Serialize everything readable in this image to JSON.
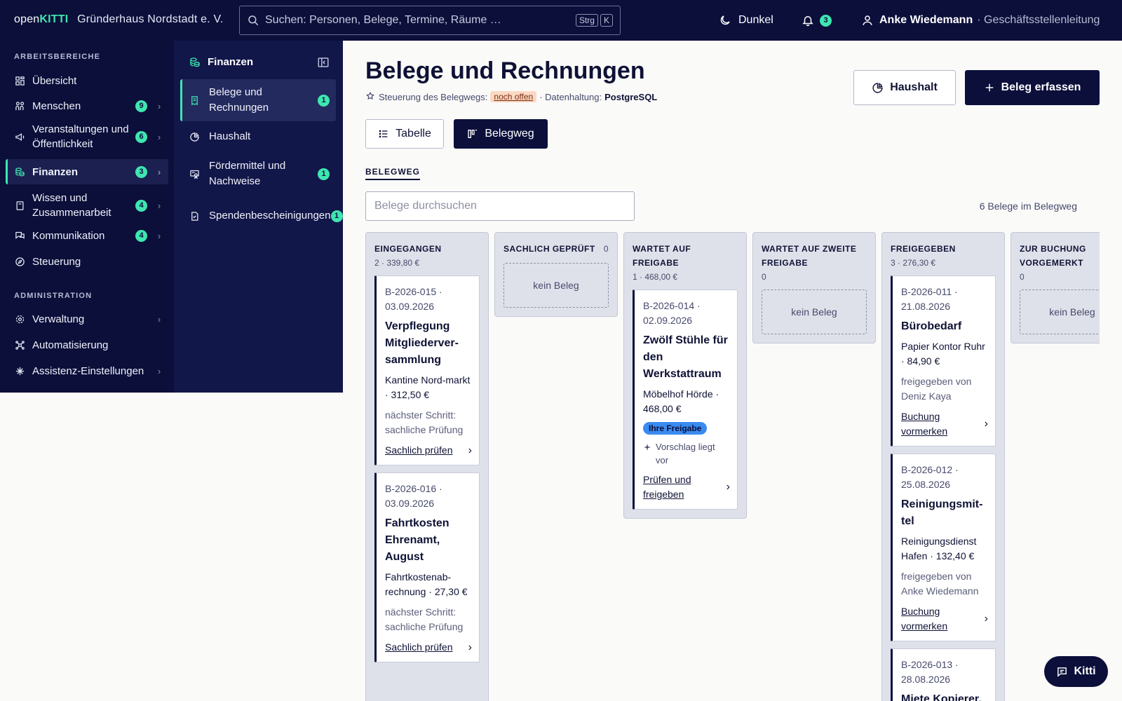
{
  "topbar": {
    "brand_open": "open",
    "brand_kitti": "KITTI",
    "org": "Gründerhaus Nordstadt e. V.",
    "search_placeholder": "Suchen: Personen, Belege, Termine, Räume …",
    "kbd_1": "Strg",
    "kbd_2": "K",
    "theme_label": "Dunkel",
    "notification_count": "3",
    "user_name": "Anke Wiedemann",
    "user_role": "· Geschäftsstellenleitung"
  },
  "nav": {
    "section_work": "ARBEITSBEREICHE",
    "section_admin": "ADMINISTRATION",
    "items": [
      {
        "label": "Übersicht",
        "badge": ""
      },
      {
        "label": "Menschen",
        "badge": "9"
      },
      {
        "label": "Veranstaltungen und Öffentlichkeit",
        "badge": "6"
      },
      {
        "label": "Finanzen",
        "badge": "3"
      },
      {
        "label": "Wissen und Zusammenarbeit",
        "badge": "4"
      },
      {
        "label": "Kommunikation",
        "badge": "4"
      },
      {
        "label": "Steuerung",
        "badge": ""
      }
    ],
    "admin_items": [
      {
        "label": "Verwaltung"
      },
      {
        "label": "Automatisierung"
      },
      {
        "label": "Assistenz-Einstellungen"
      }
    ]
  },
  "subnav": {
    "title": "Finanzen",
    "items": [
      {
        "label": "Belege und Rechnungen",
        "badge": "1"
      },
      {
        "label": "Haushalt",
        "badge": ""
      },
      {
        "label": "Fördermittel und Nachweise",
        "badge": "1"
      },
      {
        "label": "Spendenbescheinigungen",
        "badge": "1"
      }
    ]
  },
  "main": {
    "title": "Belege und Rechnungen",
    "meta_prefix": "Steuerung des Belegwegs:",
    "meta_status": "noch offen",
    "meta_storage_label": "· Datenhaltung:",
    "meta_storage_value": "PostgreSQL",
    "btn_budget": "Haushalt",
    "btn_add": "Beleg erfassen",
    "view_table": "Tabelle",
    "view_board": "Belegweg",
    "tab_label": "BELEGWEG",
    "filter_placeholder": "Belege durchsuchen",
    "count_text": "6 Belege im Belegweg"
  },
  "board": {
    "columns": [
      {
        "title": "EINGEGANGEN",
        "count": "",
        "summary": "2 · 339,80 €"
      },
      {
        "title": "SACHLICH GEPRÜFT",
        "count": "0",
        "summary": "",
        "empty": "kein Beleg"
      },
      {
        "title": "WARTET AUF FREIGABE",
        "count": "",
        "summary": "1 · 468,00 €"
      },
      {
        "title": "WARTET AUF ZWEITE FREIGABE",
        "count": "",
        "summary": "0",
        "empty": "kein Beleg"
      },
      {
        "title": "FREIGEGEBEN",
        "count": "",
        "summary": "3 · 276,30 €"
      },
      {
        "title": "ZUR BUCHUNG VORGEMERKT",
        "count": "",
        "summary": "0",
        "empty": "kein Beleg"
      }
    ],
    "cards": [
      {
        "ref": "B-2026-015 · 03.09.2026",
        "title": "Verpflegung Mitgliederver-sammlung",
        "sub": "Kantine Nord-markt · 312,50 €",
        "note": "nächster Schritt: sachliche Prüfung",
        "action": "Sachlich prüfen"
      },
      {
        "ref": "B-2026-016 · 03.09.2026",
        "title": "Fahrtkosten Ehrenamt, August",
        "sub": "Fahrtkostenab-rechnung · 27,30 €",
        "note": "nächster Schritt: sachliche Prüfung",
        "action": "Sachlich prüfen"
      },
      {
        "ref": "B-2026-014 · 02.09.2026",
        "title": "Zwölf Stühle für den Werkstattraum",
        "sub": "Möbelhof Hörde · 468,00 €",
        "badge": "Ihre Freigabe",
        "suggest": "Vorschlag liegt vor",
        "action": "Prüfen und freigeben"
      },
      {
        "ref": "B-2026-011 · 21.08.2026",
        "title": "Bürobedarf",
        "sub": "Papier Kontor Ruhr · 84,90 €",
        "note": "freigegeben von Deniz Kaya",
        "action": "Buchung vormerken"
      },
      {
        "ref": "B-2026-012 · 25.08.2026",
        "title": "Reinigungsmit-tel",
        "sub": "Reinigungsdienst Hafen · 132,40 €",
        "note": "freigegeben von Anke Wiedemann",
        "action": "Buchung vormerken"
      },
      {
        "ref": "B-2026-013 · 28.08.2026",
        "title": "Miete Kopierer,"
      }
    ]
  },
  "assistant": {
    "label": "Kitti"
  }
}
